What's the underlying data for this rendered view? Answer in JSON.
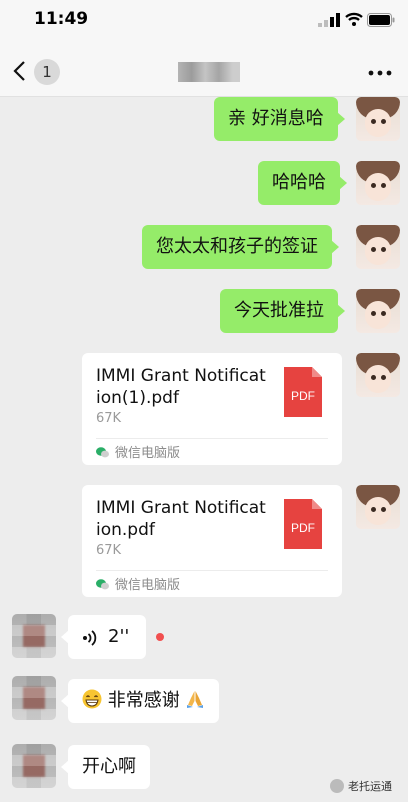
{
  "status_bar": {
    "time": "11:49"
  },
  "nav": {
    "back_badge": "1"
  },
  "messages": {
    "m1": "亲 好消息哈",
    "m2": "哈哈哈",
    "m3": "您太太和孩子的签证",
    "m4": "今天批准拉",
    "file1": {
      "name": "IMMI Grant Notification(1).pdf",
      "size": "67K",
      "source": "微信电脑版",
      "icon_label": "PDF"
    },
    "file2": {
      "name": "IMMI Grant Notification.pdf",
      "size": "67K",
      "source": "微信电脑版",
      "icon_label": "PDF"
    },
    "voice_duration": "2''",
    "reply1": "非常感谢",
    "reply2": "开心啊"
  },
  "watermark": "老托运通",
  "colors": {
    "self_bubble": "#95ec69",
    "other_bubble": "#ffffff",
    "pdf_red": "#e64340",
    "unread_red": "#f14f4f"
  }
}
